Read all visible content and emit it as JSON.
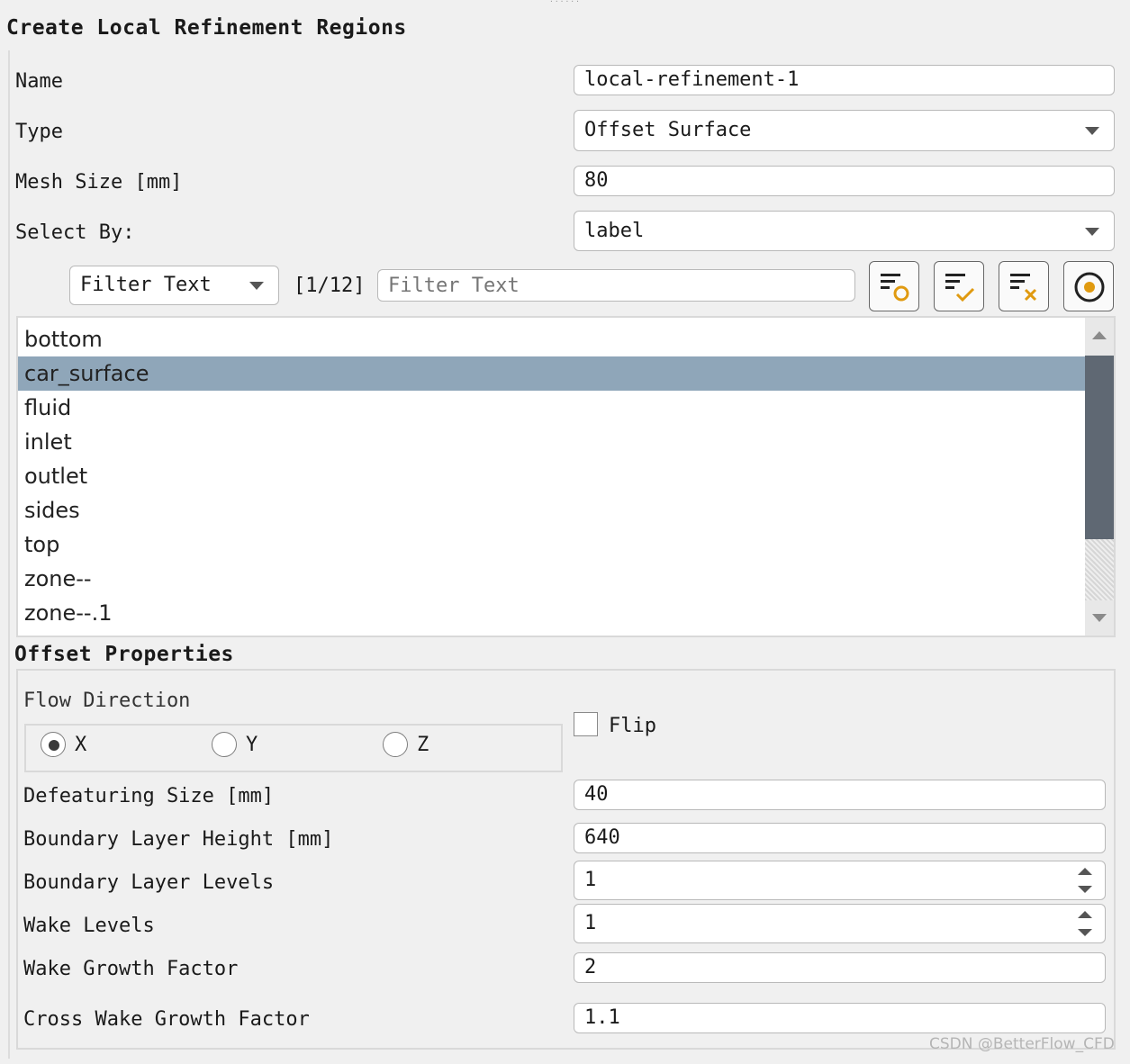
{
  "panel": {
    "title": "Create Local Refinement Regions"
  },
  "form": {
    "name_label": "Name",
    "name_value": "local-refinement-1",
    "type_label": "Type",
    "type_value": "Offset Surface",
    "mesh_size_label": "Mesh Size [mm]",
    "mesh_size_value": "80",
    "select_by_label": "Select By:",
    "select_by_value": "label"
  },
  "filter": {
    "mode_value": "Filter Text",
    "count": "[1/12]",
    "placeholder": "Filter Text",
    "icons": [
      "filter-options-icon",
      "filter-select-all-icon",
      "filter-clear-icon",
      "filter-toggle-icon"
    ]
  },
  "list": {
    "items": [
      {
        "label": "bottom",
        "selected": false
      },
      {
        "label": "car_surface",
        "selected": true
      },
      {
        "label": "fluid",
        "selected": false
      },
      {
        "label": "inlet",
        "selected": false
      },
      {
        "label": "outlet",
        "selected": false
      },
      {
        "label": "sides",
        "selected": false
      },
      {
        "label": "top",
        "selected": false
      },
      {
        "label": "zone--",
        "selected": false
      },
      {
        "label": "zone--.1",
        "selected": false
      }
    ]
  },
  "offset": {
    "title": "Offset Properties",
    "flow_direction_label": "Flow Direction",
    "directions": [
      {
        "label": "X",
        "checked": true
      },
      {
        "label": "Y",
        "checked": false
      },
      {
        "label": "Z",
        "checked": false
      }
    ],
    "flip_label": "Flip",
    "flip_checked": false,
    "defeaturing_label": "Defeaturing Size [mm]",
    "defeaturing_value": "40",
    "bl_height_label": "Boundary Layer Height [mm]",
    "bl_height_value": "640",
    "bl_levels_label": "Boundary Layer Levels",
    "bl_levels_value": "1",
    "wake_levels_label": "Wake Levels",
    "wake_levels_value": "1",
    "wake_growth_label": "Wake Growth Factor",
    "wake_growth_value": "2",
    "cross_wake_label": "Cross Wake Growth Factor",
    "cross_wake_value": "1.1"
  },
  "watermark": "CSDN @BetterFlow_CFD"
}
